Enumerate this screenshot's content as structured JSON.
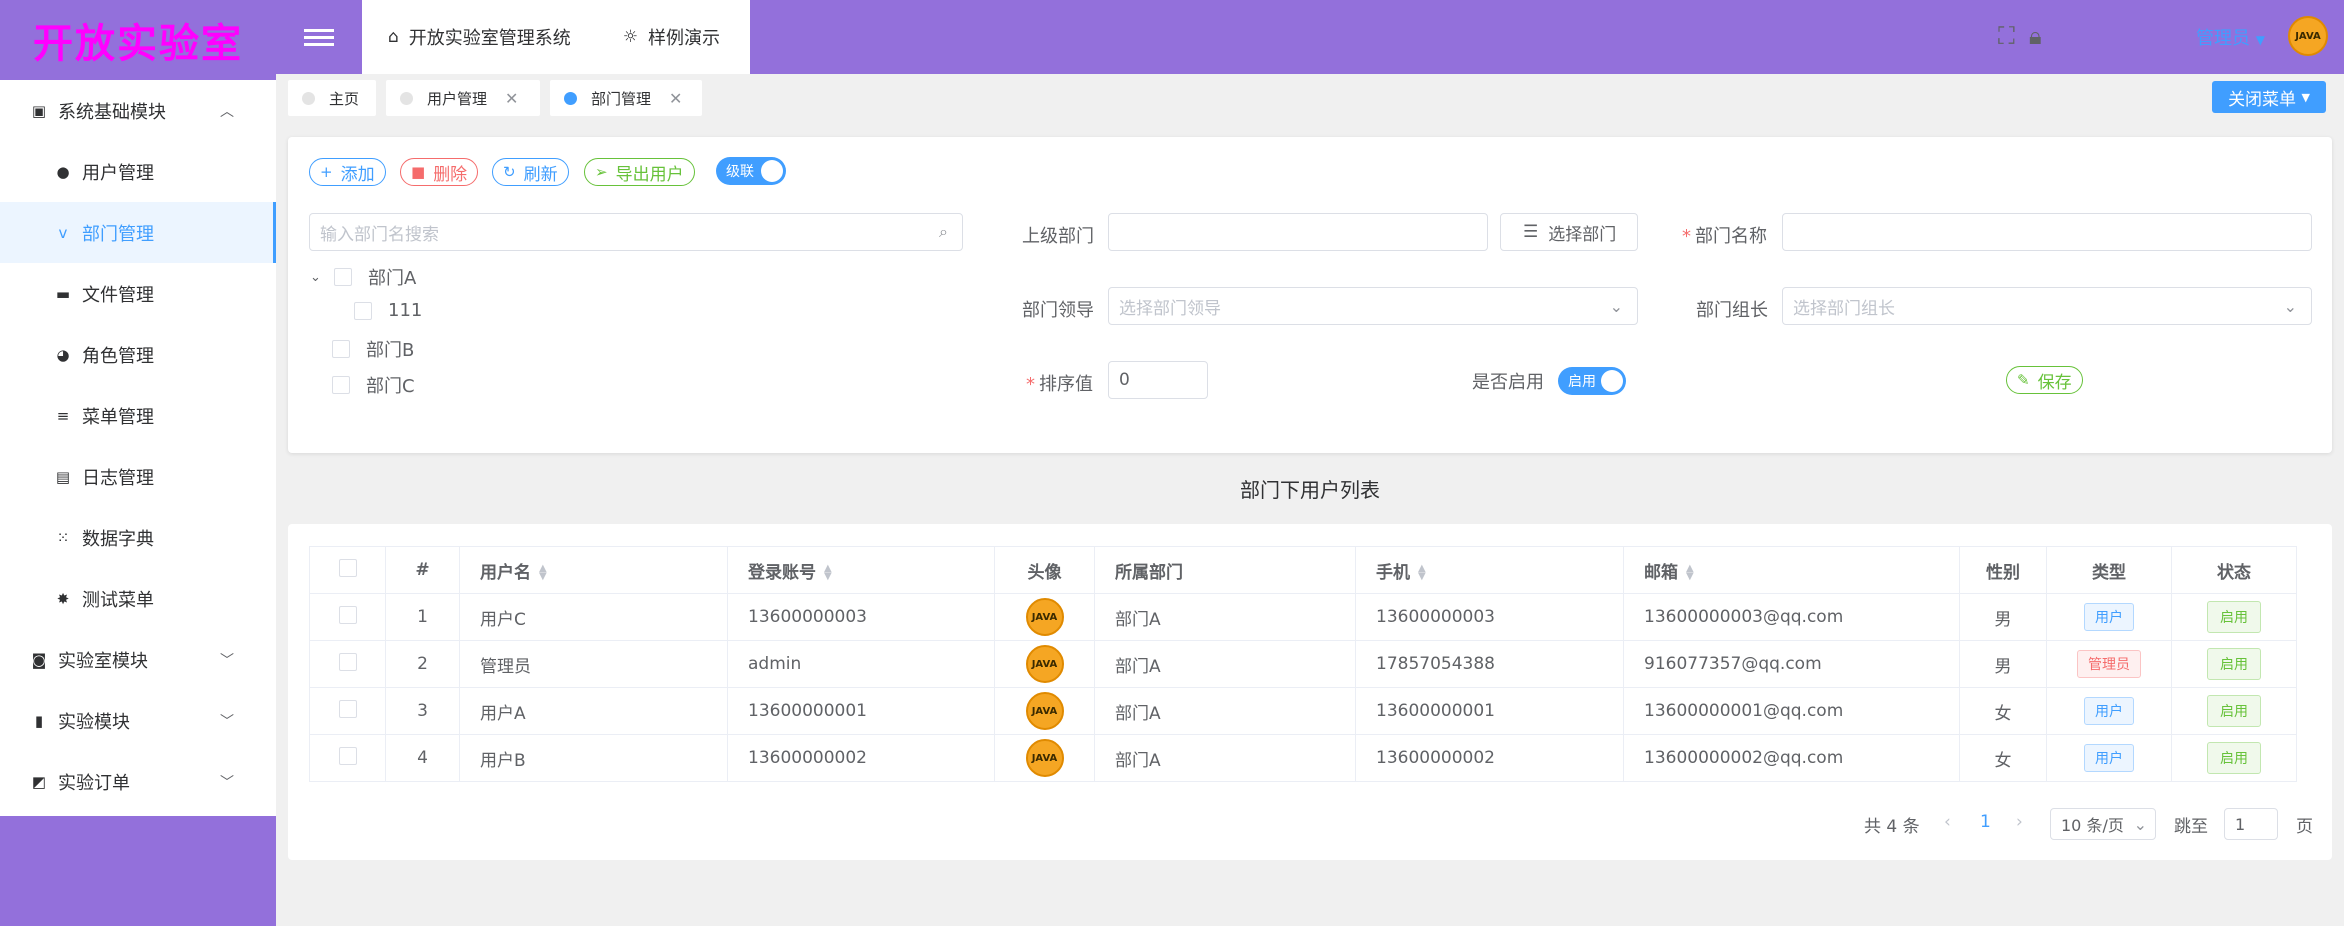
{
  "app": {
    "logo": "开放实验室"
  },
  "header": {
    "nav": [
      {
        "icon": "home-icon",
        "label": "开放实验室管理系统"
      },
      {
        "icon": "lightbulb-icon",
        "label": "样例演示"
      }
    ],
    "user": "管理员"
  },
  "avatar_text": "JAVA",
  "sidebar": {
    "items": [
      {
        "label": "系统基础模块",
        "icon": "chart-icon",
        "level": "top",
        "arrow": "︿"
      },
      {
        "label": "用户管理",
        "icon": "user-icon",
        "level": "sub"
      },
      {
        "label": "部门管理",
        "icon": "department-icon",
        "level": "sub",
        "active": true
      },
      {
        "label": "文件管理",
        "icon": "folder-icon",
        "level": "sub"
      },
      {
        "label": "角色管理",
        "icon": "role-icon",
        "level": "sub"
      },
      {
        "label": "菜单管理",
        "icon": "menu-icon",
        "level": "sub"
      },
      {
        "label": "日志管理",
        "icon": "log-icon",
        "level": "sub"
      },
      {
        "label": "数据字典",
        "icon": "grid-icon",
        "level": "sub"
      },
      {
        "label": "测试菜单",
        "icon": "bug-icon",
        "level": "sub"
      },
      {
        "label": "实验室模块",
        "icon": "flask-icon",
        "level": "top",
        "arrow": "﹀"
      },
      {
        "label": "实验模块",
        "icon": "clipboard-icon",
        "level": "top",
        "arrow": "﹀"
      },
      {
        "label": "实验订单",
        "icon": "order-icon",
        "level": "top",
        "arrow": "﹀"
      }
    ]
  },
  "tabs": [
    {
      "label": "主页",
      "closable": false
    },
    {
      "label": "用户管理",
      "closable": true
    },
    {
      "label": "部门管理",
      "closable": true,
      "active": true
    }
  ],
  "close_menu": "关闭菜单",
  "toolbar": {
    "add": "添加",
    "delete": "删除",
    "refresh": "刷新",
    "export": "导出用户",
    "cascade": "级联"
  },
  "tree": {
    "search_placeholder": "输入部门名搜索",
    "nodes": [
      {
        "label": "部门A",
        "depth": 0,
        "expanded": true
      },
      {
        "label": "111",
        "depth": 1
      },
      {
        "label": "部门B",
        "depth": 0
      },
      {
        "label": "部门C",
        "depth": 0
      }
    ]
  },
  "form": {
    "parent_label": "上级部门",
    "parent_value": "",
    "select_dept": "选择部门",
    "name_label": "部门名称",
    "name_value": "",
    "leader_label": "部门领导",
    "leader_placeholder": "选择部门领导",
    "head_label": "部门组长",
    "head_placeholder": "选择部门组长",
    "sort_label": "排序值",
    "sort_value": "0",
    "enabled_label": "是否启用",
    "enabled_switch": "启用",
    "save": "保存"
  },
  "list_title": "部门下用户列表",
  "table": {
    "headers": [
      "#",
      "用户名",
      "登录账号",
      "头像",
      "所属部门",
      "手机",
      "邮箱",
      "性别",
      "类型",
      "状态"
    ],
    "rows": [
      {
        "no": "1",
        "username": "用户C",
        "account": "13600000003",
        "dept": "部门A",
        "phone": "13600000003",
        "email": "13600000003@qq.com",
        "gender": "男",
        "type": "用户",
        "status": "启用"
      },
      {
        "no": "2",
        "username": "管理员",
        "account": "admin",
        "dept": "部门A",
        "phone": "17857054388",
        "email": "916077357@qq.com",
        "gender": "男",
        "type": "管理员",
        "status": "启用"
      },
      {
        "no": "3",
        "username": "用户A",
        "account": "13600000001",
        "dept": "部门A",
        "phone": "13600000001",
        "email": "13600000001@qq.com",
        "gender": "女",
        "type": "用户",
        "status": "启用"
      },
      {
        "no": "4",
        "username": "用户B",
        "account": "13600000002",
        "dept": "部门A",
        "phone": "13600000002",
        "email": "13600000002@qq.com",
        "gender": "女",
        "type": "用户",
        "status": "启用"
      }
    ]
  },
  "pagination": {
    "total": "共 4 条",
    "current": "1",
    "page_size": "10 条/页",
    "goto": "跳至",
    "goto_value": "1",
    "page_unit": "页"
  }
}
